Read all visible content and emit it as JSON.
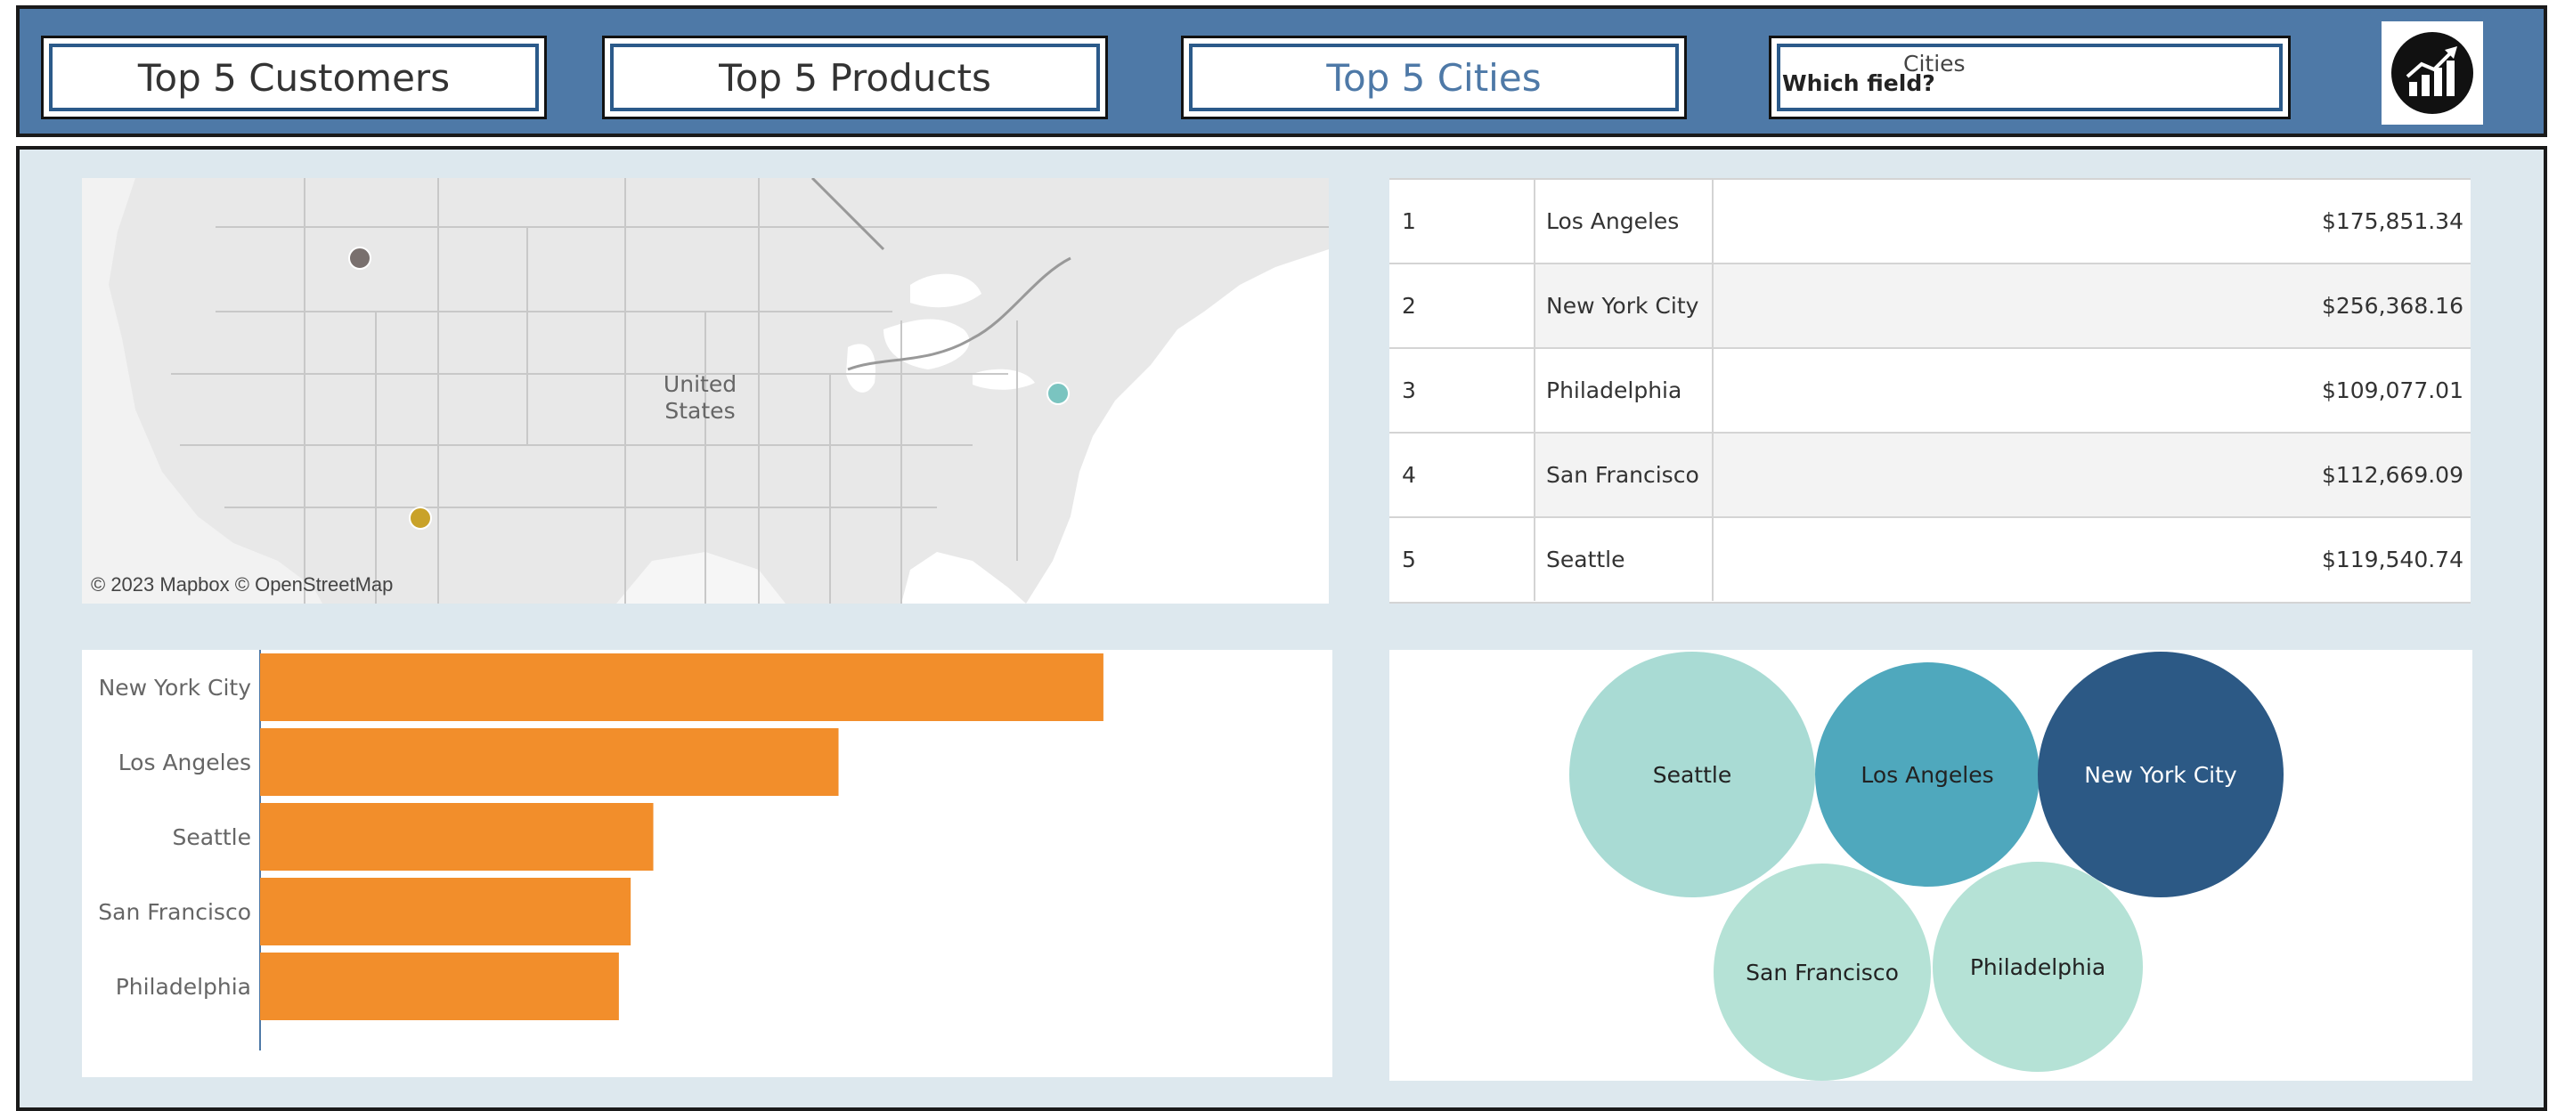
{
  "header": {
    "nav": [
      {
        "label": "Top 5 Customers",
        "active": false
      },
      {
        "label": "Top 5 Products",
        "active": false
      },
      {
        "label": "Top 5 Cities",
        "active": true
      }
    ],
    "parameter": {
      "label": "Which field?",
      "value": "Cities"
    },
    "logo_icon": "bar-chart-growth-icon"
  },
  "map": {
    "country_label_line1": "United",
    "country_label_line2": "States",
    "attribution": "© 2023 Mapbox © OpenStreetMap",
    "marker_colors": {
      "Seattle": "#79706e",
      "Los Angeles": "#c9a229",
      "New York City": "#7ac4c0"
    }
  },
  "table": {
    "rows": [
      {
        "rank": "1",
        "city": "Los Angeles",
        "sales": "$175,851.34"
      },
      {
        "rank": "2",
        "city": "New York City",
        "sales": "$256,368.16"
      },
      {
        "rank": "3",
        "city": "Philadelphia",
        "sales": "$109,077.01"
      },
      {
        "rank": "4",
        "city": "San Francisco",
        "sales": "$112,669.09"
      },
      {
        "rank": "5",
        "city": "Seattle",
        "sales": "$119,540.74"
      }
    ]
  },
  "chart_data": [
    {
      "type": "bar",
      "orientation": "horizontal",
      "categories": [
        "New York City",
        "Los Angeles",
        "Seattle",
        "San Francisco",
        "Philadelphia"
      ],
      "values": [
        256368.16,
        175851.34,
        119540.74,
        112669.09,
        109077.01
      ],
      "bar_color": "#f28e2b",
      "xlim": [
        0,
        310000
      ]
    },
    {
      "type": "bubble",
      "categories": [
        "Seattle",
        "Los Angeles",
        "New York City",
        "San Francisco",
        "Philadelphia"
      ],
      "colors": {
        "Seattle": "#a9dbd4",
        "Los Angeles": "#4fa8bd",
        "New York City": "#2c5985",
        "San Francisco": "#b5e2d6",
        "Philadelphia": "#b5e2d6"
      }
    }
  ]
}
